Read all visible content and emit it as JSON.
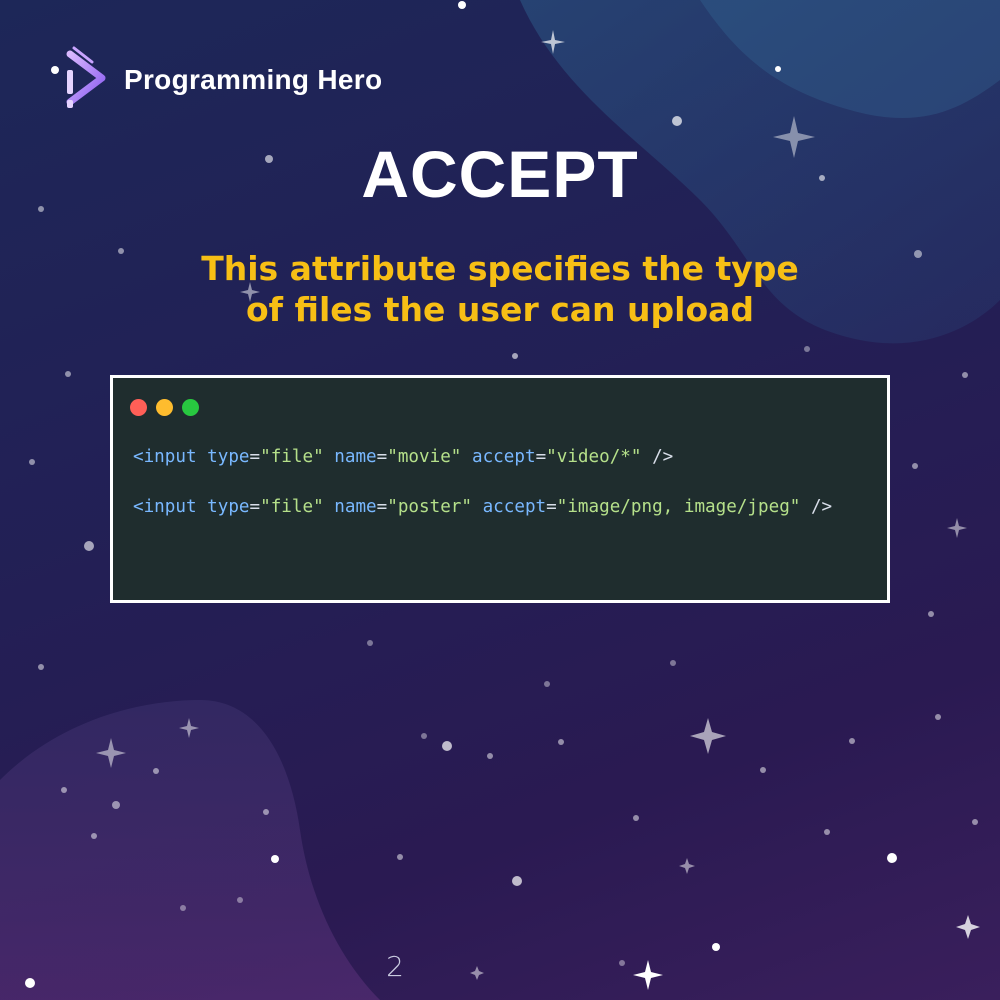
{
  "brand": {
    "name": "Programming Hero",
    "logo_icon": "programming-hero-logo-icon"
  },
  "slide": {
    "title": "ACCEPT",
    "subtitle_line1": "This attribute specifies the type",
    "subtitle_line2": "of files the user can upload",
    "page_number": "2"
  },
  "code_window": {
    "dots": [
      "#ff5f57",
      "#febc2e",
      "#28c840"
    ],
    "line1": {
      "open": "<input",
      "attr1": "type",
      "eq1": "=",
      "val1": "\"file\"",
      "attr2": "name",
      "eq2": "=",
      "val2": "\"movie\"",
      "attr3": "accept",
      "eq3": "=",
      "val3": "\"video/*\"",
      "close": "/>"
    },
    "line2": {
      "open": "<input",
      "attr1": "type",
      "eq1": "=",
      "val1": "\"file\"",
      "attr2": "name",
      "eq2": "=",
      "val2": "\"poster\"",
      "attr3": "accept",
      "eq3": "=",
      "val3": "\"image/png, image/jpeg\"",
      "close": "/>"
    }
  },
  "colors": {
    "title": "#ffffff",
    "subtitle": "#f7bf15",
    "code_background": "#1f2d2e",
    "code_tag": "#79b8ff",
    "code_string": "#b5e08a"
  }
}
